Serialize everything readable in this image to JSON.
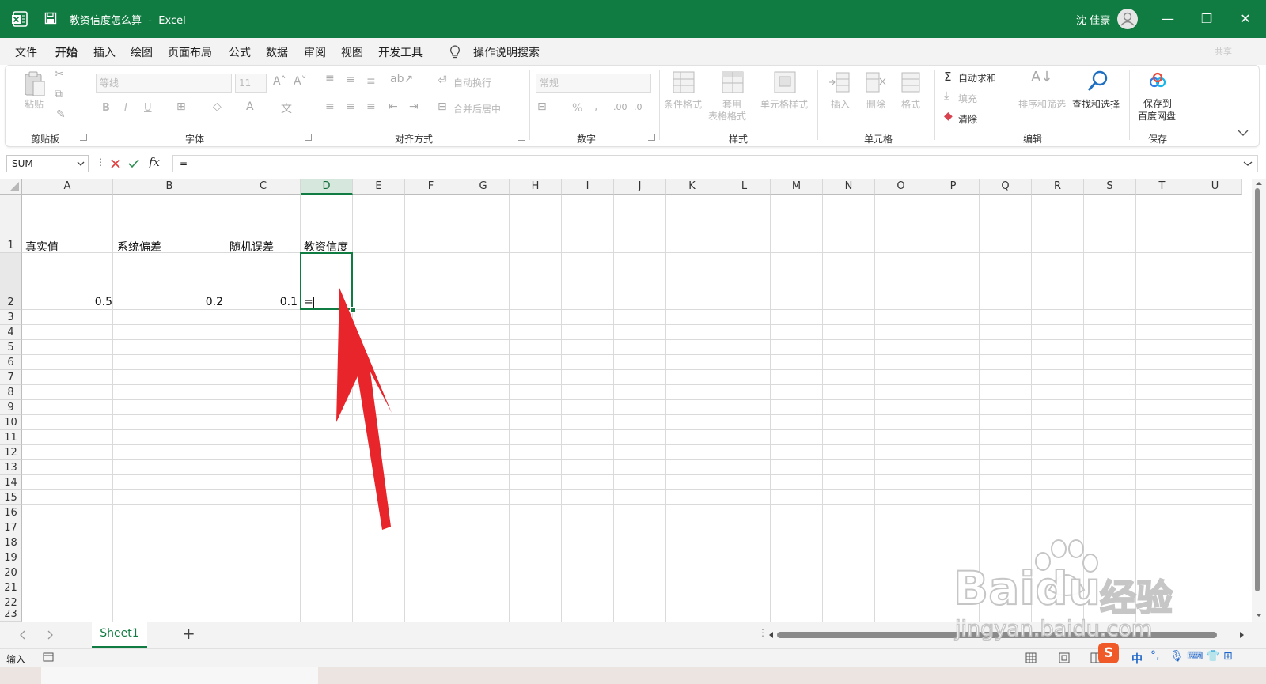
{
  "window": {
    "doc_title": "教资信度怎么算",
    "app_name": "Excel",
    "user_name": "沈 佳豪",
    "minimize": "—",
    "restore": "❐",
    "close": "✕"
  },
  "menu": {
    "tabs": [
      "文件",
      "开始",
      "插入",
      "绘图",
      "页面布局",
      "公式",
      "数据",
      "审阅",
      "视图",
      "开发工具"
    ],
    "active_tab": "开始",
    "search_label": "操作说明搜索",
    "share_label": "共享"
  },
  "ribbon": {
    "clipboard": {
      "label": "剪贴板",
      "paste": "粘贴"
    },
    "font": {
      "label": "字体",
      "font_name": "等线",
      "font_size": "11",
      "bold": "B",
      "italic": "I",
      "underline": "U"
    },
    "alignment": {
      "label": "对齐方式",
      "wrap_text": "自动换行",
      "merge_center": "合并后居中"
    },
    "number": {
      "label": "数字",
      "format": "常规",
      "percent": "%",
      "comma": ","
    },
    "styles": {
      "label": "样式",
      "conditional_format": "条件格式",
      "table_format_1": "套用",
      "table_format_2": "表格格式",
      "cell_styles": "单元格样式"
    },
    "cells": {
      "label": "单元格",
      "insert": "插入",
      "delete": "删除",
      "format": "格式"
    },
    "editing": {
      "label": "编辑",
      "autosum": "自动求和",
      "fill": "填充",
      "clear": "清除",
      "sort_filter": "排序和筛选",
      "find_select": "查找和选择"
    },
    "save": {
      "label": "保存",
      "save_to_1": "保存到",
      "save_to_2": "百度网盘"
    }
  },
  "formula_bar": {
    "name_box": "SUM",
    "fx": "fx",
    "content": "="
  },
  "columns": [
    "A",
    "B",
    "C",
    "D",
    "E",
    "F",
    "G",
    "H",
    "I",
    "J",
    "K",
    "L",
    "M",
    "N",
    "O",
    "P",
    "Q",
    "R",
    "S",
    "T",
    "U"
  ],
  "selected_column": "D",
  "rows": [
    "1",
    "2",
    "3",
    "4",
    "5",
    "6",
    "7",
    "8",
    "9",
    "10",
    "11",
    "12",
    "13",
    "14",
    "15",
    "16",
    "17",
    "18",
    "19",
    "20",
    "21",
    "22",
    "23"
  ],
  "cells": {
    "A1": "真实值",
    "B1": "系统偏差",
    "C1": "随机误差",
    "D1": "教资信度",
    "A2": "0.5",
    "B2": "0.2",
    "C2": "0.1",
    "D2": "="
  },
  "sheets": {
    "active": "Sheet1",
    "add": "+"
  },
  "status": {
    "mode": "输入"
  },
  "watermark": {
    "logo": "Baidu",
    "cn": "经验",
    "site": "jingyan.baidu.com"
  },
  "colors": {
    "accent": "#107c41",
    "arrow": "#e8252a"
  }
}
